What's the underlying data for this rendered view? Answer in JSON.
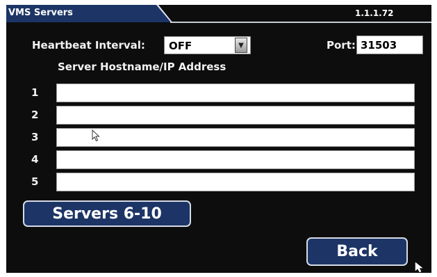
{
  "window": {
    "title": "VMS Servers",
    "version": "1.1.1.72"
  },
  "heartbeat": {
    "label": "Heartbeat Interval:",
    "value": "OFF"
  },
  "port": {
    "label": "Port:",
    "value": "31503"
  },
  "servers": {
    "column_header": "Server Hostname/IP Address",
    "rows": [
      {
        "number": "1",
        "value": ""
      },
      {
        "number": "2",
        "value": ""
      },
      {
        "number": "3",
        "value": ""
      },
      {
        "number": "4",
        "value": ""
      },
      {
        "number": "5",
        "value": ""
      }
    ]
  },
  "buttons": {
    "more_servers": "Servers 6-10",
    "back": "Back"
  },
  "colors": {
    "accent": "#1c3566",
    "background": "#0d0d0d",
    "text": "#f2f2f2"
  }
}
